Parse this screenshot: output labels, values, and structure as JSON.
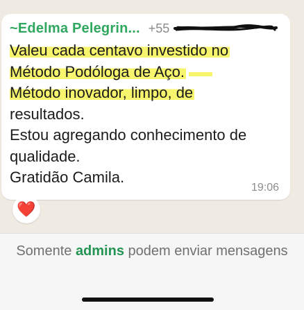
{
  "message": {
    "sender_name": "~Edelma Pelegrin...",
    "sender_phone": "+55",
    "lines": [
      "Valeu cada centavo investido no",
      "Método Podóloga de Aço.",
      "Método inovador, limpo, de",
      "resultados.",
      "Estou agregando conhecimento de",
      "qualidade.",
      "Gratidão Camila."
    ],
    "time": "19:06",
    "reaction": "❤️"
  },
  "footer": {
    "prefix": "Somente ",
    "admins": "admins",
    "suffix": " podem enviar mensagens"
  },
  "colors": {
    "sender": "#2fa75f",
    "highlight": "#f7f56e",
    "admins": "#239454",
    "chat_bg": "#efeae2"
  }
}
